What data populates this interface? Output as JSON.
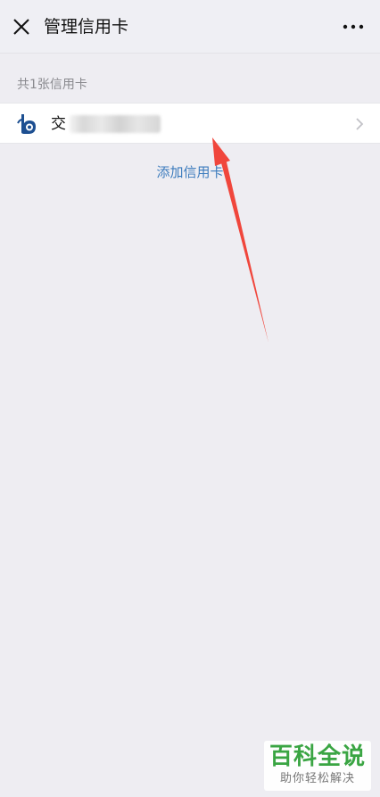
{
  "header": {
    "title": "管理信用卡",
    "close_icon": "close-icon",
    "more_icon": "more-icon"
  },
  "cards": {
    "count_label": "共1张信用卡",
    "items": [
      {
        "bank_name": "交",
        "logo_icon": "bank-logo-icon",
        "logo_color": "#1d4f91"
      }
    ]
  },
  "actions": {
    "add_label": "添加信用卡"
  },
  "annotation": {
    "arrow_color": "#f0463c"
  },
  "watermark": {
    "main": "百科全说",
    "sub": "助你轻松解决",
    "color": "#3aa543"
  }
}
